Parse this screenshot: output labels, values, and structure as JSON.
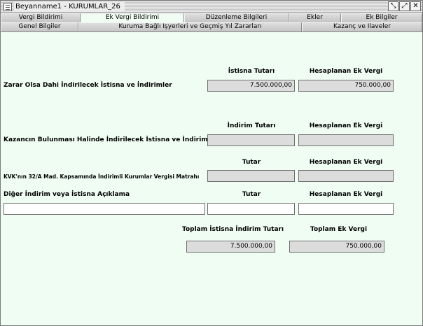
{
  "window": {
    "title": "Beyanname1 - KURUMLAR_26",
    "buttons": {
      "restore": "⤡",
      "maximize": "⤢",
      "close": "✕"
    }
  },
  "tabs_row1": [
    "Vergi Bildirimi",
    "Ek Vergi Bildirimi",
    "Düzenleme Bilgileri",
    "Ekler",
    "Ek Bilgiler"
  ],
  "tabs_row2": [
    "Genel Bilgiler",
    "Kuruma Bağlı İşyerleri ve Geçmiş Yıl Zararları",
    "Kazanç ve İlaveler"
  ],
  "active_tab": "Ek Vergi Bildirimi",
  "section1": {
    "col1": "İstisna Tutarı",
    "col2": "Hesaplanan Ek Vergi",
    "label": "Zarar Olsa Dahi İndirilecek İstisna ve İndirimler",
    "value1": "7.500.000,00",
    "value2": "750.000,00"
  },
  "section2": {
    "col1": "İndirim Tutarı",
    "col2": "Hesaplanan Ek Vergi",
    "label": "Kazancın Bulunması Halinde İndirilecek İstisna ve İndirimler",
    "value1": "",
    "value2": ""
  },
  "section3": {
    "col1": "Tutar",
    "col2": "Hesaplanan Ek Vergi",
    "label": "KVK'nın 32/A Mad. Kapsamında İndirimli Kurumlar Vergisi Matrahı",
    "value1": "",
    "value2": ""
  },
  "section4": {
    "label": "Diğer İndirim veya İstisna Açıklama",
    "col1": "Tutar",
    "col2": "Hesaplanan Ek Vergi",
    "description": "",
    "value1": "",
    "value2": ""
  },
  "totals": {
    "label1": "Toplam İstisna İndirim Tutarı",
    "label2": "Toplam Ek Vergi",
    "value1": "7.500.000,00",
    "value2": "750.000,00"
  }
}
